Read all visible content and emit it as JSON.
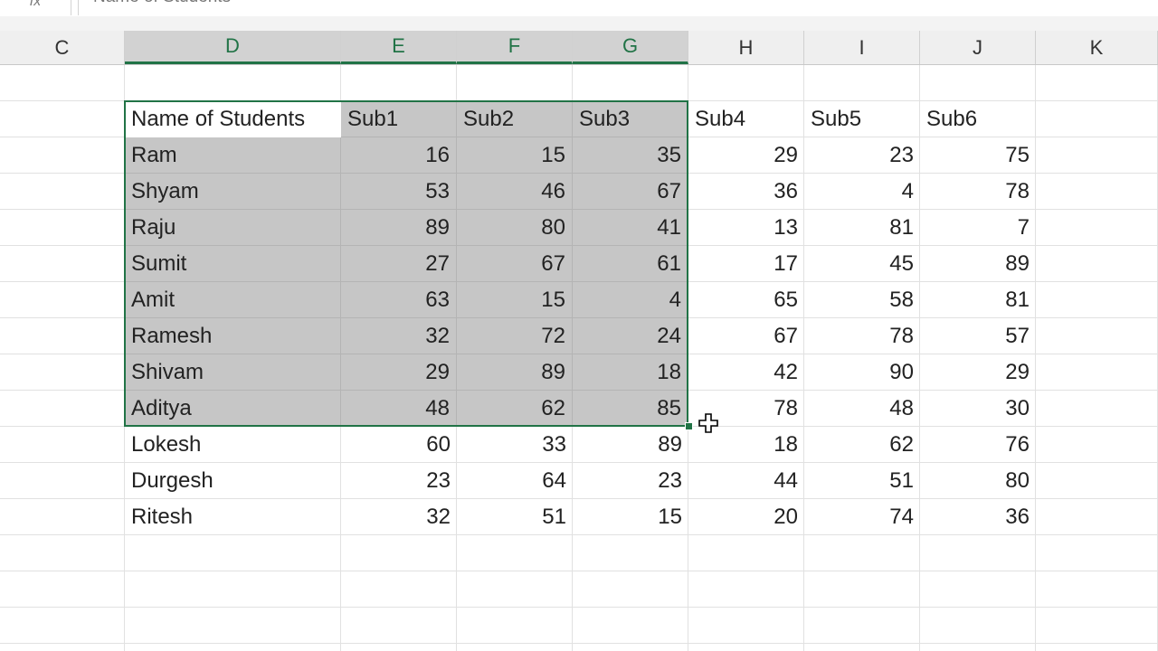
{
  "formula_bar": {
    "fx_label": "fx",
    "content": "Name of Students"
  },
  "columns": [
    "C",
    "D",
    "E",
    "F",
    "G",
    "H",
    "I",
    "J",
    "K"
  ],
  "selected_columns": [
    "D",
    "E",
    "F",
    "G"
  ],
  "table": {
    "headers": [
      "Name of Students",
      "Sub1",
      "Sub2",
      "Sub3",
      "Sub4",
      "Sub5",
      "Sub6"
    ],
    "rows": [
      [
        "Ram",
        "16",
        "15",
        "35",
        "29",
        "23",
        "75"
      ],
      [
        "Shyam",
        "53",
        "46",
        "67",
        "36",
        "4",
        "78"
      ],
      [
        "Raju",
        "89",
        "80",
        "41",
        "13",
        "81",
        "7"
      ],
      [
        "Sumit",
        "27",
        "67",
        "61",
        "17",
        "45",
        "89"
      ],
      [
        "Amit",
        "63",
        "15",
        "4",
        "65",
        "58",
        "81"
      ],
      [
        "Ramesh",
        "32",
        "72",
        "24",
        "67",
        "78",
        "57"
      ],
      [
        "Shivam",
        "29",
        "89",
        "18",
        "42",
        "90",
        "29"
      ],
      [
        "Aditya",
        "48",
        "62",
        "85",
        "78",
        "48",
        "30"
      ],
      [
        "Lokesh",
        "60",
        "33",
        "89",
        "18",
        "62",
        "76"
      ],
      [
        "Durgesh",
        "23",
        "64",
        "23",
        "44",
        "51",
        "80"
      ],
      [
        "Ritesh",
        "32",
        "51",
        "15",
        "20",
        "74",
        "36"
      ]
    ]
  },
  "colors": {
    "accent": "#217346",
    "selection_fill": "#c6c6c6",
    "header_bg": "#efefef"
  },
  "cursor_icon": "cross-cursor-icon"
}
